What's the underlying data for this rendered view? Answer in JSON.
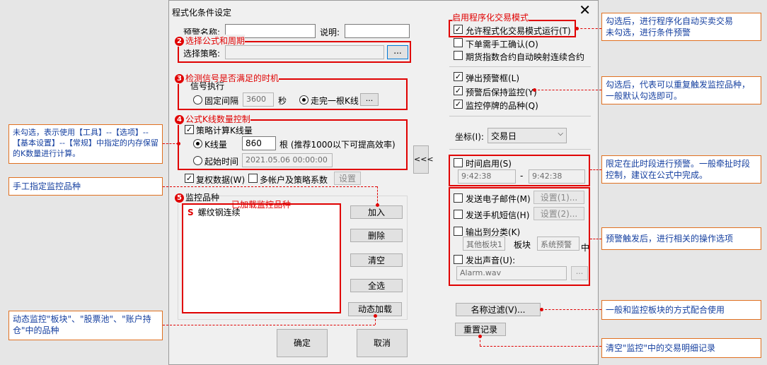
{
  "dialog": {
    "title": "程式化条件设定",
    "close_glyph": "✕"
  },
  "form": {
    "alert_name_label": "预警名称:",
    "alert_name_value": "",
    "desc_label": "说明:",
    "desc_value": "",
    "strategy_label": "选择策略:",
    "strategy_value": "",
    "browse_label": "...",
    "signal_group_label": "信号执行",
    "fixed_interval_label": "固定间隔",
    "fixed_interval_value": "3600",
    "seconds_label": "秒",
    "after_kline_label": "走完一根K线",
    "after_kline_btn": "...",
    "strategy_kline_label": "策略计算K线量",
    "kline_count_label": "K线量",
    "kline_count_value": "860",
    "kline_hint": "根 (推荐1000以下可提高效率)",
    "start_time_label": "起始时间",
    "start_time_value": "2021.05.06 00:00:00",
    "adjust_label": "复权数据(W)",
    "multi_account_label": "多帐户及策略系数",
    "settings_btn": "设置",
    "monitor_group_label": "监控品种",
    "monitor_list": [
      {
        "prefix": "S",
        "name": "螺纹钢连续"
      }
    ],
    "add_btn": "加入",
    "delete_btn": "删除",
    "clear_btn": "清空",
    "select_all_btn": "全选",
    "dynamic_load_btn": "动态加载",
    "ok_btn": "确定",
    "cancel_btn": "取消",
    "collapse_btn": "<<<"
  },
  "right": {
    "allow_prog_label": "允许程式化交易模式运行(T)",
    "need_confirm_label": "下单需手工确认(O)",
    "futures_map_label": "期货指数合约自动映射连续合约",
    "popup_label": "弹出预警框(L)",
    "keep_monitor_label": "预警后保持监控(Y)",
    "suspended_label": "监控停牌的品种(Q)",
    "coord_label": "坐标(I):",
    "coord_value": "交易日",
    "time_enable_label": "时间启用(S)",
    "time_start": "9:42:38",
    "time_sep": "-",
    "time_end": "9:42:38",
    "email_label": "发送电子邮件(M)",
    "email_btn": "设置(1)...",
    "sms_label": "发送手机短信(H)",
    "sms_btn": "设置(2)...",
    "output_label": "输出到分类(K)",
    "other_block": "其他板块1",
    "block_label": "板块",
    "alert_block": "系统预警",
    "mid_label": "中",
    "sound_label": "发出声音(U):",
    "sound_file": "Alarm.wav",
    "sound_btn": "...",
    "name_filter_btn": "名称过滤(V)...",
    "reset_log_btn": "重置记录"
  },
  "annotations": {
    "enable_prog_mode": "启用程序化交易模式",
    "select_formula": "选择公式和周期",
    "detect_signal": "检测信号是否满足的时机",
    "kline_control": "公式K线数量控制",
    "monitor_items": "监控品种",
    "loaded_items": "已加载监控品种",
    "badge2": "2",
    "badge3": "3",
    "badge4": "4",
    "badge5": "5"
  },
  "notes": {
    "note_kline": "未勾选，表示使用【工具】--【选项】--【基本设置】--【常规】中指定的内存保留的K数量进行计算。",
    "note_manual": "手工指定监控品种",
    "note_dynamic": "动态监控\"板块\"、\"股票池\"、\"账户持仓\"中的品种",
    "note_prog": "勾选后，进行程序化自动买卖交易\n未勾选，进行条件预警",
    "note_repeat": "勾选后，代表可以重复触发监控品种，一般默认勾选即可。",
    "note_time": "限定在此时段进行预警。一般牵扯时段控制，建议在公式中完成。",
    "note_trigger": "预警触发后，进行相关的操作选项",
    "note_filter": "一般和监控板块的方式配合使用",
    "note_reset": "清空\"监控\"中的交易明细记录"
  },
  "colors": {
    "accent_red": "#e00000",
    "note_text": "#1640a0",
    "note_border": "#e07020"
  }
}
